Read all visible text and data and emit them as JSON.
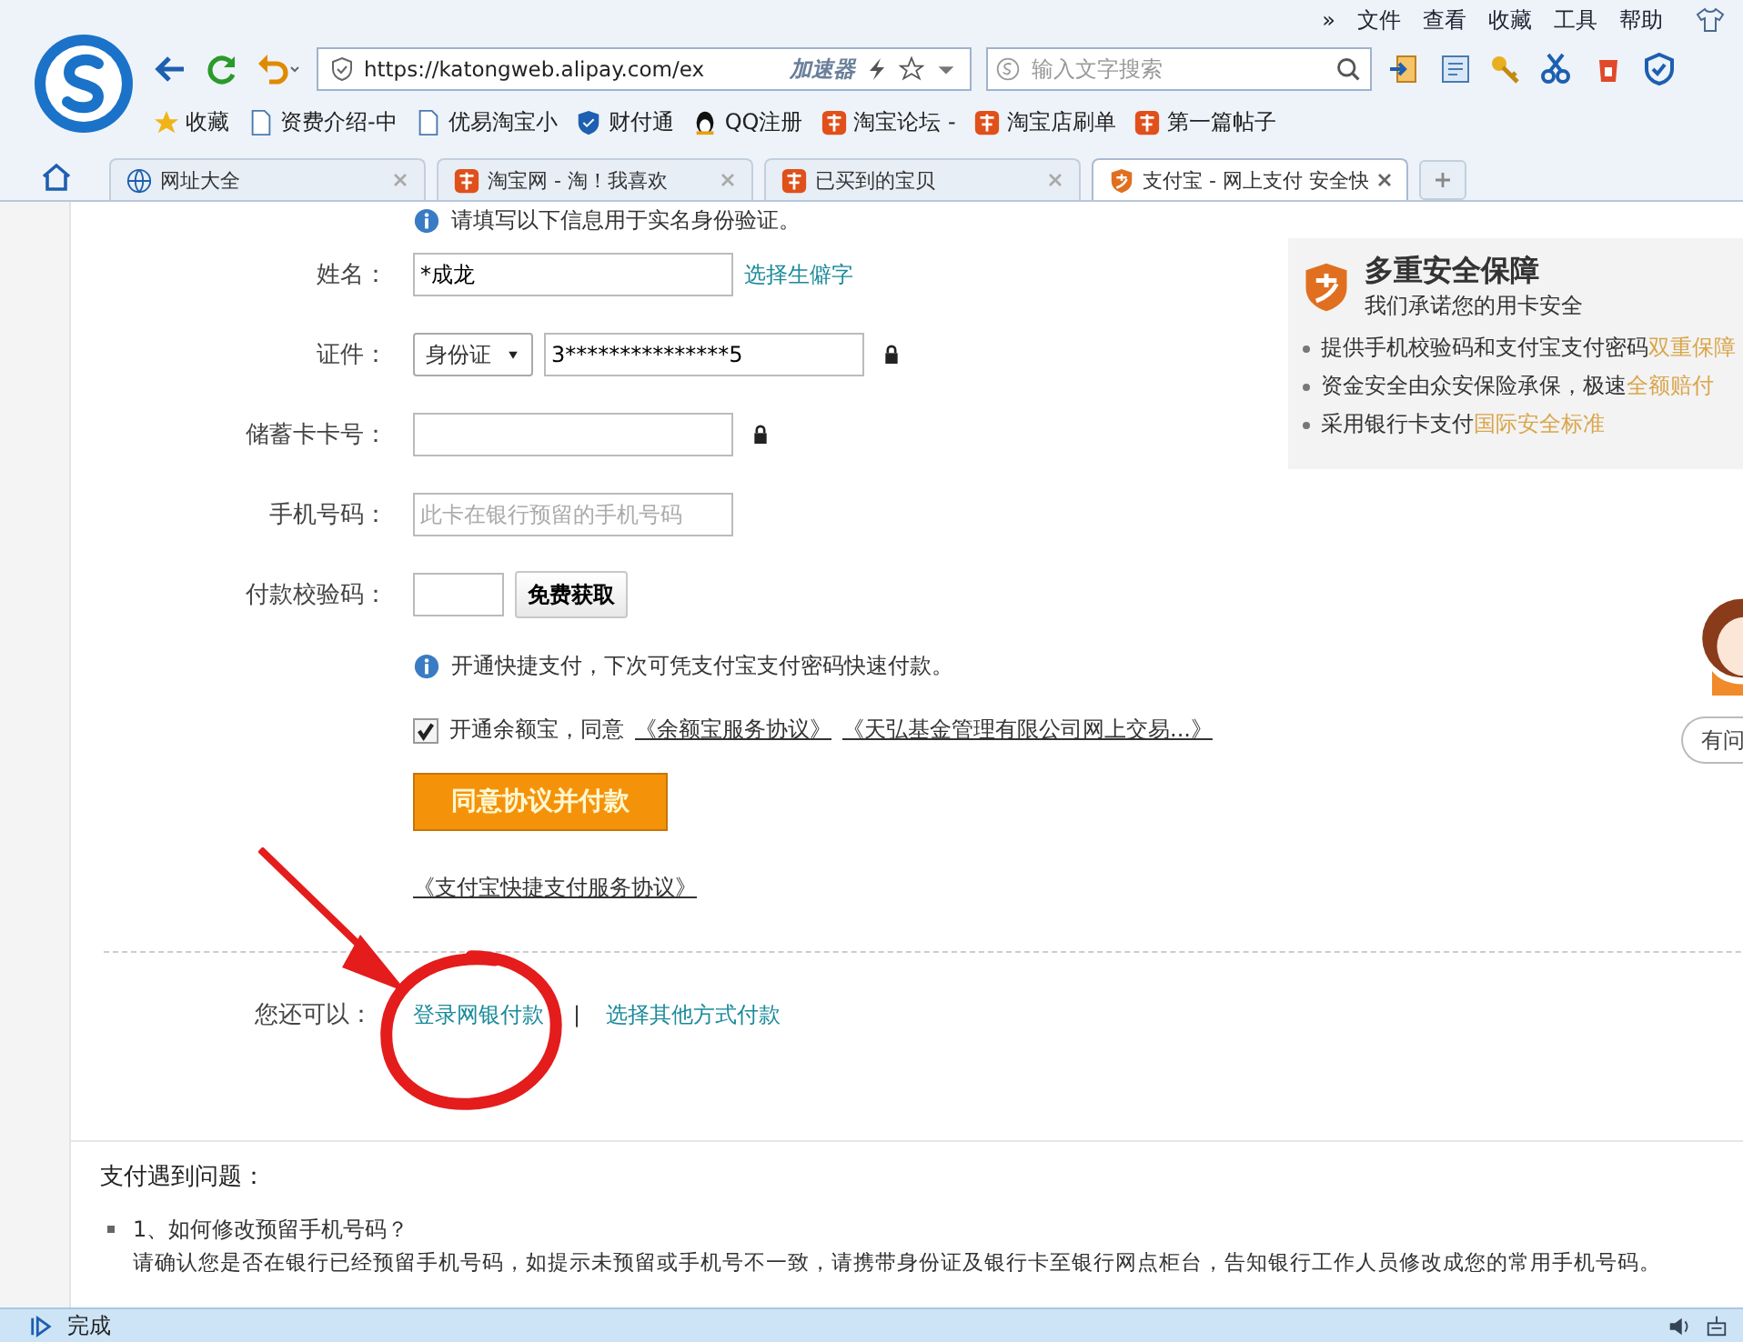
{
  "menu_bar": [
    "»",
    "文件",
    "查看",
    "收藏",
    "工具",
    "帮助"
  ],
  "address_bar": {
    "url": "https://katongweb.alipay.com/ex",
    "accelerator": "加速器"
  },
  "search": {
    "placeholder": "输入文字搜索"
  },
  "bookmarks": [
    {
      "label": "收藏",
      "kind": "star"
    },
    {
      "label": "资费介绍-中",
      "kind": "page"
    },
    {
      "label": "优易淘宝小",
      "kind": "page"
    },
    {
      "label": "财付通",
      "kind": "shield"
    },
    {
      "label": "QQ注册",
      "kind": "penguin"
    },
    {
      "label": "淘宝论坛 -",
      "kind": "taobao"
    },
    {
      "label": "淘宝店刷单",
      "kind": "taobao"
    },
    {
      "label": "第一篇帖子",
      "kind": "taobao"
    }
  ],
  "tabs": [
    {
      "label": "网址大全",
      "kind": "globe",
      "selected": false
    },
    {
      "label": "淘宝网 - 淘！我喜欢",
      "kind": "taobao",
      "selected": false
    },
    {
      "label": "已买到的宝贝",
      "kind": "taobao",
      "selected": false
    },
    {
      "label": "支付宝 - 网上支付 安全快",
      "kind": "alipay",
      "selected": true
    }
  ],
  "form": {
    "notice": "请填写以下信息用于实名身份验证。",
    "fields": [
      {
        "kind": "text",
        "label": "姓名：",
        "value": "*成龙",
        "link": "选择生僻字"
      },
      {
        "kind": "id",
        "label": "证件：",
        "select": "身份证",
        "value": "3***************5",
        "locked": true
      },
      {
        "kind": "text",
        "label": "储蓄卡卡号：",
        "locked": true
      },
      {
        "kind": "text",
        "label": "手机号码：",
        "placeholder": "此卡在银行预留的手机号码"
      },
      {
        "kind": "code",
        "label": "付款校验码：",
        "button": "免费获取"
      }
    ],
    "quick_pay_notice": "开通快捷支付，下次可凭支付宝支付密码快速付款。",
    "agreement": {
      "checked": true,
      "text": "开通余额宝，同意",
      "links": [
        "《余额宝服务协议》",
        "《天弘基金管理有限公司网上交易...》"
      ]
    },
    "submit": "同意协议并付款",
    "service_link": "《支付宝快捷支付服务协议》"
  },
  "alternatives": {
    "label": "您还可以：",
    "links": [
      "登录网银付款",
      "选择其他方式付款"
    ],
    "separator": "|"
  },
  "security": {
    "title": "多重安全保障",
    "subtitle": "我们承诺您的用卡安全",
    "items": [
      {
        "text": "提供手机校验码和支付宝支付密码",
        "highlight": "双重保障"
      },
      {
        "text": "资金安全由众安保险承保，极速",
        "highlight": "全额赔付"
      },
      {
        "text": "采用银行卡支付",
        "highlight": "国际安全标准"
      }
    ]
  },
  "help_button": "有问",
  "faq": {
    "title": "支付遇到问题：",
    "items": [
      {
        "question": "1、如何修改预留手机号码？",
        "answer": "请确认您是否在银行已经预留手机号码，如提示未预留或手机号不一致，请携带身份证及银行卡至银行网点柜台，告知银行工作人员修改成您的常用手机号码。"
      }
    ]
  },
  "status_bar": {
    "text": "完成"
  }
}
